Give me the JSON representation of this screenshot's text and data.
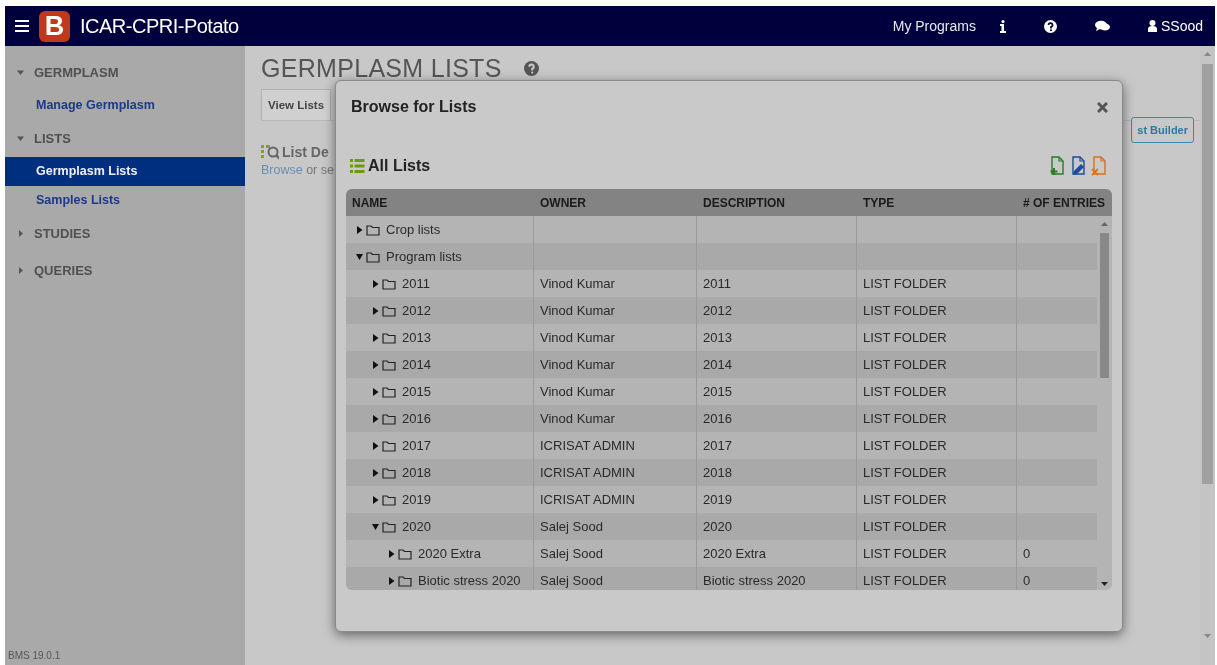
{
  "header": {
    "logo_letter": "B",
    "app_name": "ICAR-CPRI-Potato",
    "links": [
      "My Programs"
    ],
    "user": "SSood"
  },
  "sidebar": {
    "sections": [
      {
        "label": "GERMPLASM",
        "expanded": true,
        "items": [
          {
            "label": "Manage Germplasm",
            "selected": false
          }
        ]
      },
      {
        "label": "LISTS",
        "expanded": true,
        "items": [
          {
            "label": "Germplasm Lists",
            "selected": true
          },
          {
            "label": "Samples Lists",
            "selected": false
          }
        ]
      },
      {
        "label": "STUDIES",
        "expanded": false
      },
      {
        "label": "QUERIES",
        "expanded": false
      }
    ],
    "version": "BMS 19.0.1"
  },
  "page": {
    "title": "GERMPLASM LISTS",
    "tabs": [
      {
        "label": "View Lists",
        "selected": true
      }
    ],
    "section_title": "List De",
    "hint_link": "Browse",
    "hint_text": " or se",
    "builder_button": "st Builder"
  },
  "modal": {
    "title": "Browse for Lists",
    "heading": "All Lists",
    "columns": [
      "NAME",
      "OWNER",
      "DESCRIPTION",
      "TYPE",
      "# OF ENTRIES"
    ],
    "tree": [
      {
        "name": "Crop lists",
        "expanded": false
      },
      {
        "name": "Program lists",
        "expanded": true,
        "children": [
          {
            "name": "2011",
            "owner": "Vinod Kumar",
            "description": "2011",
            "type": "LIST FOLDER",
            "expanded": false
          },
          {
            "name": "2012",
            "owner": "Vinod Kumar",
            "description": "2012",
            "type": "LIST FOLDER",
            "expanded": false
          },
          {
            "name": "2013",
            "owner": "Vinod Kumar",
            "description": "2013",
            "type": "LIST FOLDER",
            "expanded": false
          },
          {
            "name": "2014",
            "owner": "Vinod Kumar",
            "description": "2014",
            "type": "LIST FOLDER",
            "expanded": false
          },
          {
            "name": "2015",
            "owner": "Vinod Kumar",
            "description": "2015",
            "type": "LIST FOLDER",
            "expanded": false
          },
          {
            "name": "2016",
            "owner": "Vinod Kumar",
            "description": "2016",
            "type": "LIST FOLDER",
            "expanded": false
          },
          {
            "name": "2017",
            "owner": "ICRISAT ADMIN",
            "description": "2017",
            "type": "LIST FOLDER",
            "expanded": false
          },
          {
            "name": "2018",
            "owner": "ICRISAT ADMIN",
            "description": "2018",
            "type": "LIST FOLDER",
            "expanded": false
          },
          {
            "name": "2019",
            "owner": "ICRISAT ADMIN",
            "description": "2019",
            "type": "LIST FOLDER",
            "expanded": false
          },
          {
            "name": "2020",
            "owner": "Salej Sood",
            "description": "2020",
            "type": "LIST FOLDER",
            "expanded": true,
            "children": [
              {
                "name": "2020 Extra",
                "owner": "Salej Sood",
                "description": "2020 Extra",
                "type": "LIST FOLDER",
                "entries": "0",
                "expanded": false
              },
              {
                "name": "Biotic stress 2020",
                "owner": "Salej Sood",
                "description": "Biotic stress 2020",
                "type": "LIST FOLDER",
                "entries": "0",
                "expanded": false
              }
            ]
          }
        ]
      }
    ]
  }
}
